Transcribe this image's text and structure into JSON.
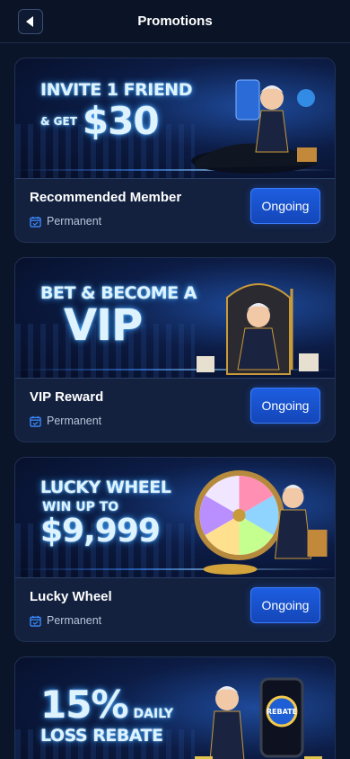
{
  "header": {
    "title": "Promotions"
  },
  "promos": [
    {
      "banner": {
        "line1": "INVITE 1 FRIEND",
        "line2": "& GET",
        "line3": "$30"
      },
      "title": "Recommended Member",
      "period": "Permanent",
      "status": "Ongoing"
    },
    {
      "banner": {
        "line1": "BET & BECOME A",
        "line2": "VIP"
      },
      "title": "VIP Reward",
      "period": "Permanent",
      "status": "Ongoing"
    },
    {
      "banner": {
        "line1": "LUCKY WHEEL",
        "line2": "WIN UP TO",
        "line3": "$9,999"
      },
      "title": "Lucky Wheel",
      "period": "Permanent",
      "status": "Ongoing"
    },
    {
      "banner": {
        "line1": "15%",
        "line2": "DAILY",
        "line3": "LOSS REBATE",
        "badge": "REBATE"
      }
    }
  ]
}
